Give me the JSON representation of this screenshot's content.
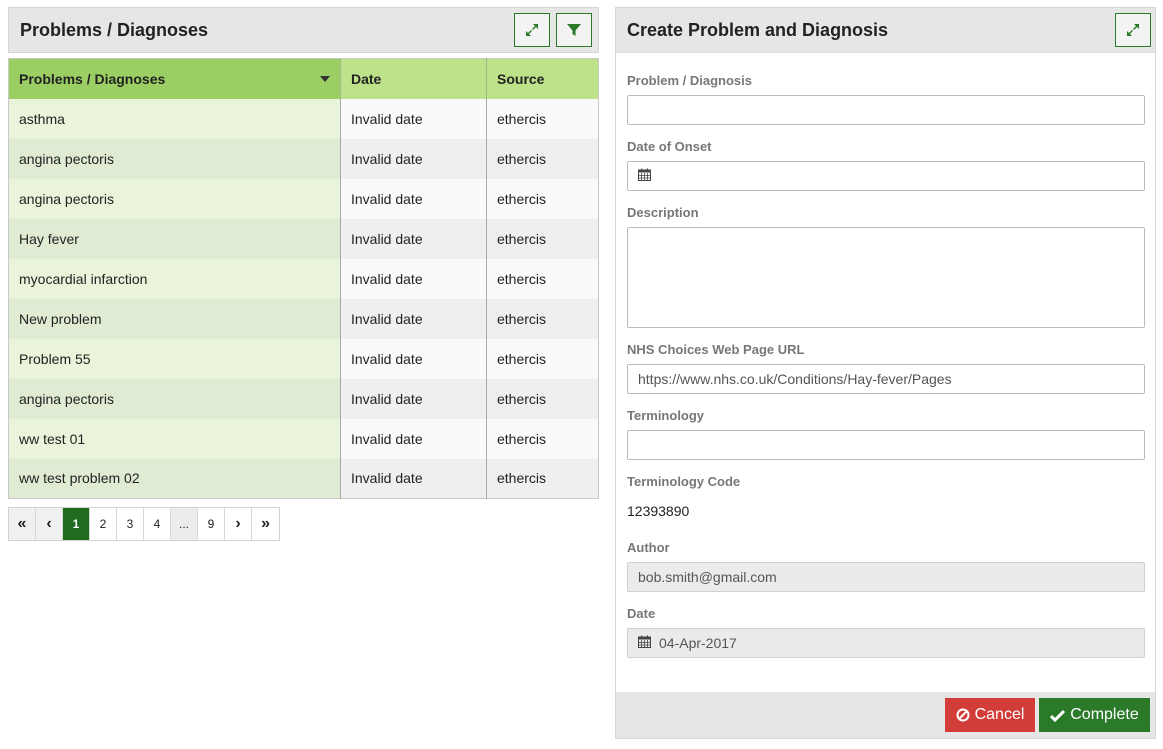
{
  "left": {
    "title": "Problems / Diagnoses",
    "table": {
      "headers": [
        "Problems / Diagnoses",
        "Date",
        "Source"
      ],
      "rows": [
        [
          "asthma",
          "Invalid date",
          "ethercis"
        ],
        [
          "angina pectoris",
          "Invalid date",
          "ethercis"
        ],
        [
          "angina pectoris",
          "Invalid date",
          "ethercis"
        ],
        [
          "Hay fever",
          "Invalid date",
          "ethercis"
        ],
        [
          "myocardial infarction",
          "Invalid date",
          "ethercis"
        ],
        [
          "New problem",
          "Invalid date",
          "ethercis"
        ],
        [
          "Problem 55",
          "Invalid date",
          "ethercis"
        ],
        [
          "angina pectoris",
          "Invalid date",
          "ethercis"
        ],
        [
          "ww test 01",
          "Invalid date",
          "ethercis"
        ],
        [
          "ww test problem 02",
          "Invalid date",
          "ethercis"
        ]
      ]
    },
    "pager": {
      "first": "«",
      "prev": "‹",
      "pages": [
        "1",
        "2",
        "3",
        "4"
      ],
      "ellipsis": "...",
      "last_page": "9",
      "next": "›",
      "last": "»",
      "current": "1"
    }
  },
  "right": {
    "title": "Create Problem and Diagnosis",
    "fields": {
      "problem_label": "Problem / Diagnosis",
      "problem_value": "",
      "onset_label": "Date of Onset",
      "onset_value": "",
      "description_label": "Description",
      "description_value": "",
      "nhs_label": "NHS Choices Web Page URL",
      "nhs_value": "https://www.nhs.co.uk/Conditions/Hay-fever/Pages",
      "terminology_label": "Terminology",
      "terminology_value": "",
      "code_label": "Terminology Code",
      "code_value": "12393890",
      "author_label": "Author",
      "author_value": "bob.smith@gmail.com",
      "date_label": "Date",
      "date_value": "04-Apr-2017"
    },
    "buttons": {
      "cancel": "Cancel",
      "complete": "Complete"
    }
  },
  "colors": {
    "accent_green": "#2a7a2a",
    "header_green": "#bde28a",
    "sorted_header_green": "#9ccf63",
    "cancel_red": "#d23d3a"
  },
  "icons": {
    "expand": "expand-icon",
    "filter": "filter-icon",
    "calendar": "calendar-icon",
    "ban": "ban-icon",
    "check": "check-icon"
  }
}
